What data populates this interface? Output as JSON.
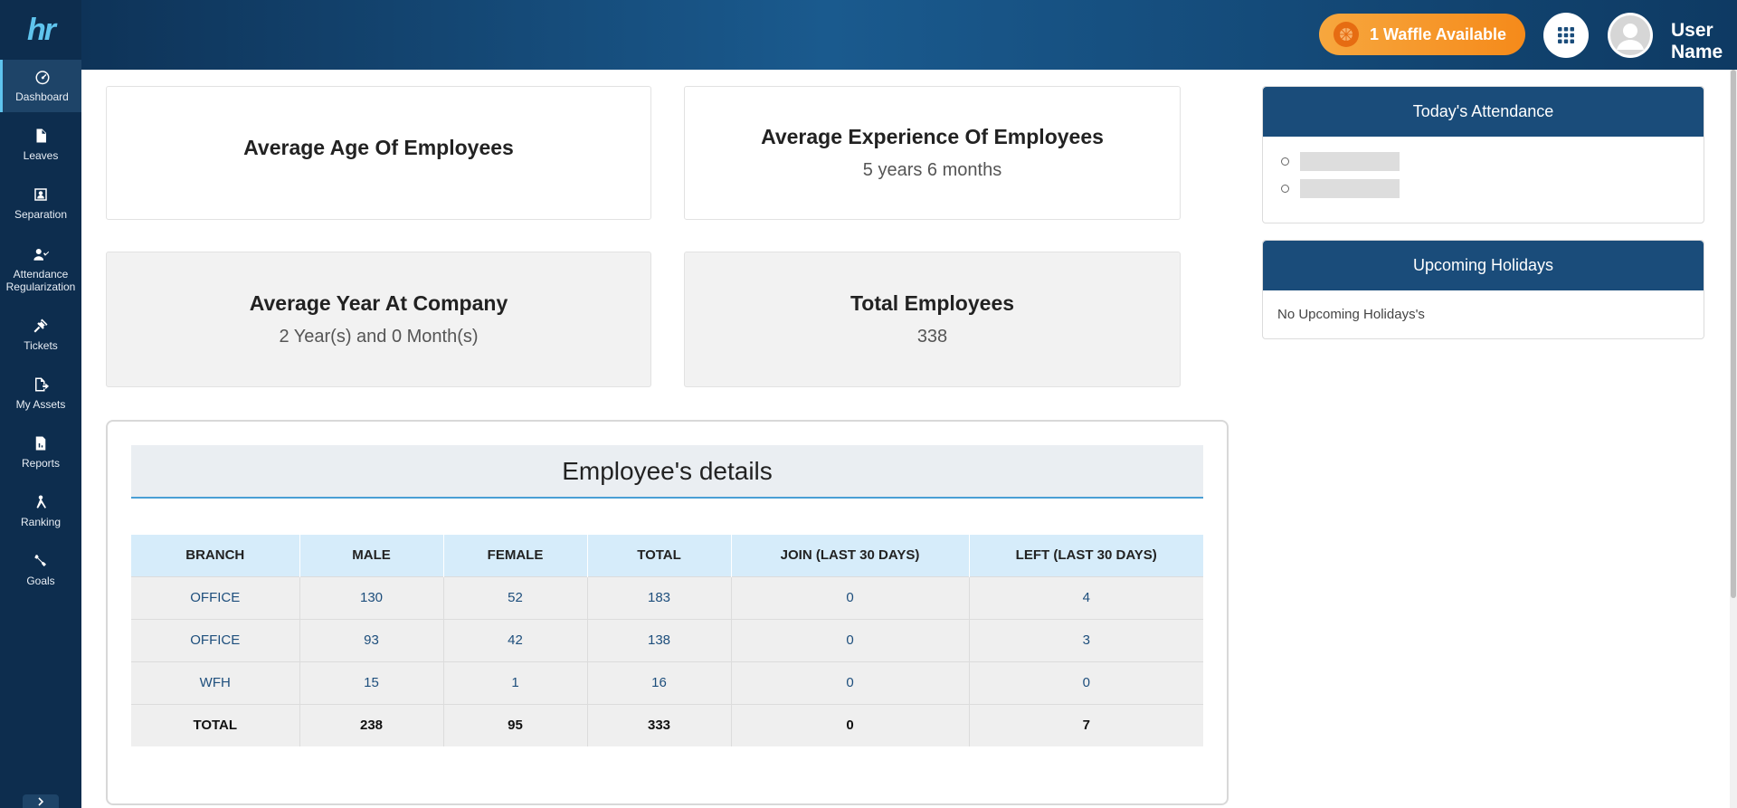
{
  "sidebar": {
    "logo": "hr",
    "items": [
      {
        "label": "Dashboard",
        "icon": "gauge-icon"
      },
      {
        "label": "Leaves",
        "icon": "document-icon"
      },
      {
        "label": "Separation",
        "icon": "user-frame-icon"
      },
      {
        "label": "Attendance Regularization",
        "icon": "user-check-icon"
      },
      {
        "label": "Tickets",
        "icon": "ticket-icon"
      },
      {
        "label": "My Assets",
        "icon": "file-export-icon"
      },
      {
        "label": "Reports",
        "icon": "report-icon"
      },
      {
        "label": "Ranking",
        "icon": "ranking-icon"
      },
      {
        "label": "Goals",
        "icon": "goal-icon"
      }
    ]
  },
  "header": {
    "waffle_label": "1 Waffle Available",
    "user_name": "User Name"
  },
  "stats": {
    "avg_age_title": "Average Age Of Employees",
    "avg_age_value": "",
    "avg_exp_title": "Average Experience Of Employees",
    "avg_exp_value": "5 years 6 months",
    "avg_year_title": "Average Year At Company",
    "avg_year_value": "2 Year(s) and 0 Month(s)",
    "total_title": "Total Employees",
    "total_value": "338"
  },
  "employee_details": {
    "title": "Employee's details",
    "columns": [
      "BRANCH",
      "MALE",
      "FEMALE",
      "TOTAL",
      "JOIN (LAST 30 DAYS)",
      "LEFT (LAST 30 DAYS)"
    ],
    "rows": [
      [
        "OFFICE",
        "130",
        "52",
        "183",
        "0",
        "4"
      ],
      [
        "OFFICE",
        "93",
        "42",
        "138",
        "0",
        "3"
      ],
      [
        "WFH",
        "15",
        "1",
        "16",
        "0",
        "0"
      ],
      [
        "TOTAL",
        "238",
        "95",
        "333",
        "0",
        "7"
      ]
    ]
  },
  "attendance": {
    "title": "Today's Attendance"
  },
  "holidays": {
    "title": "Upcoming Holidays",
    "empty_text": "No Upcoming Holidays's"
  }
}
